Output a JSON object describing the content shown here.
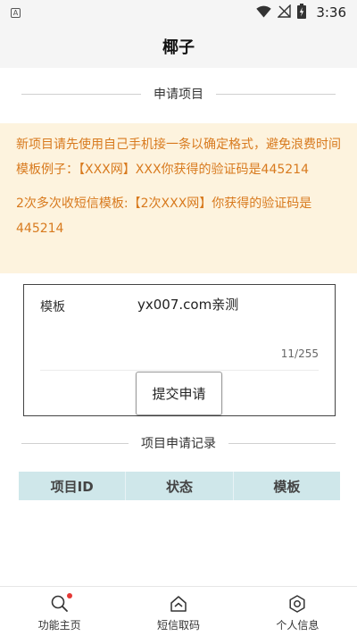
{
  "status_bar": {
    "notification_icon_letter": "A",
    "time": "3:36",
    "icons": [
      "wifi-icon",
      "no-signal-icon",
      "battery-charging-icon"
    ]
  },
  "app": {
    "title": "椰子"
  },
  "apply_section": {
    "header": "申请项目",
    "notice_1": "新项目请先使用自己手机接一条以确定格式，避免浪费时间 模板例子：【XXX网】XXX你获得的验证码是445214",
    "notice_2": "2次多次收短信模板:【2次XXX网】你获得的验证码是445214",
    "form": {
      "template_label": "模板",
      "template_value": "yx007.com亲测",
      "char_count": "11/255",
      "submit_label": "提交申请"
    }
  },
  "records_section": {
    "header": "项目申请记录",
    "columns": [
      "项目ID",
      "状态",
      "模板"
    ]
  },
  "bottom_nav": [
    {
      "label": "功能主页",
      "icon": "search-icon",
      "badge": true
    },
    {
      "label": "短信取码",
      "icon": "home-icon",
      "badge": false
    },
    {
      "label": "个人信息",
      "icon": "settings-icon",
      "badge": false
    }
  ],
  "colors": {
    "notice_bg": "#fdf3de",
    "notice_text": "#d87a1e",
    "table_header_bg": "#cfe7ea",
    "badge": "#e53935"
  }
}
